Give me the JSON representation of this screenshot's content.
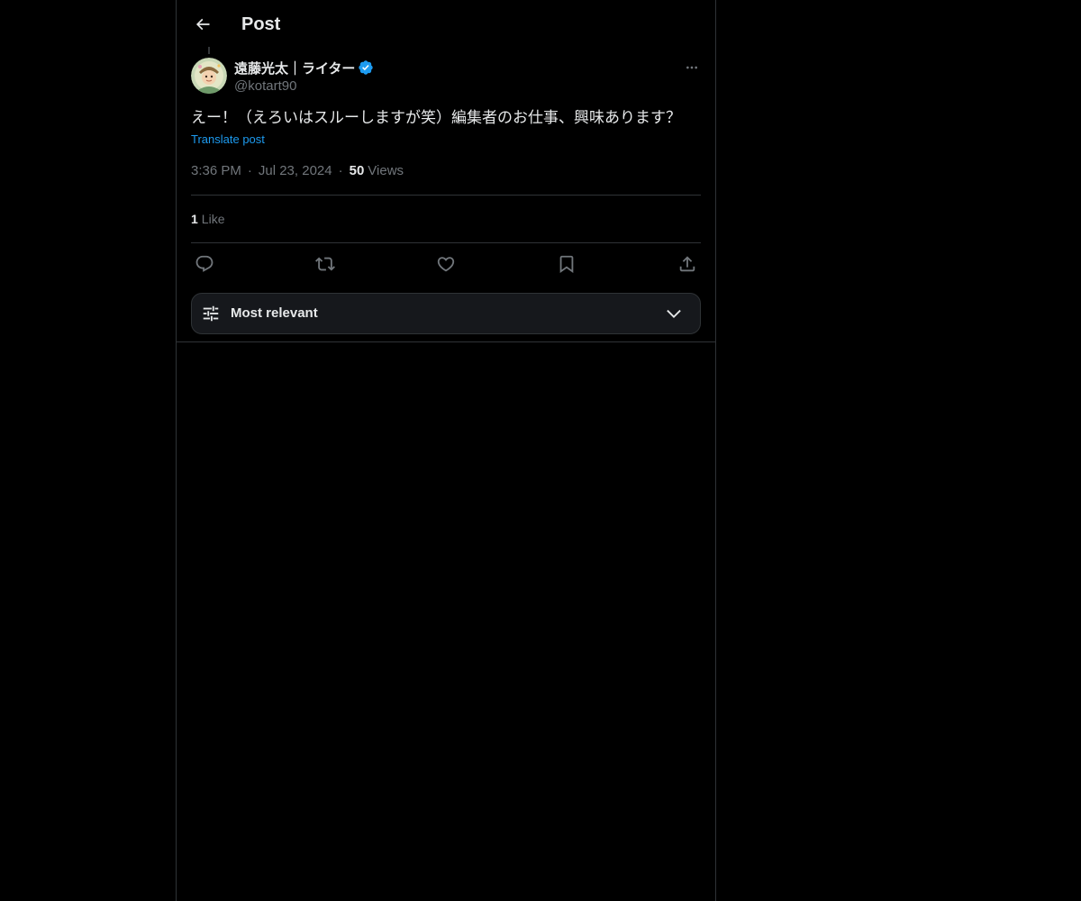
{
  "header": {
    "title": "Post",
    "back_icon": "arrow-left-icon"
  },
  "post": {
    "author": {
      "display_name": "遠藤光太｜ライター",
      "handle": "@kotart90",
      "verified": true,
      "verified_color": "#1d9bf0"
    },
    "text": "えー！（えろいはスルーしますが笑）編集者のお仕事、興味あります？",
    "translate_label": "Translate post",
    "time": "3:36 PM",
    "date": "Jul 23, 2024",
    "separator": "·",
    "views_count": "50",
    "views_label": "Views",
    "likes_count": "1",
    "likes_label": "Like"
  },
  "actions": [
    {
      "name": "reply",
      "icon": "reply-icon"
    },
    {
      "name": "repost",
      "icon": "repost-icon"
    },
    {
      "name": "like",
      "icon": "heart-icon"
    },
    {
      "name": "bookmark",
      "icon": "bookmark-icon"
    },
    {
      "name": "share",
      "icon": "share-icon"
    }
  ],
  "replies_sort": {
    "label": "Most relevant",
    "icon": "sliders-icon",
    "chevron": "chevron-down-icon"
  },
  "colors": {
    "background": "#000000",
    "text": "#e7e9ea",
    "secondary": "#71767b",
    "accent": "#1d9bf0",
    "border": "#2f3336"
  }
}
